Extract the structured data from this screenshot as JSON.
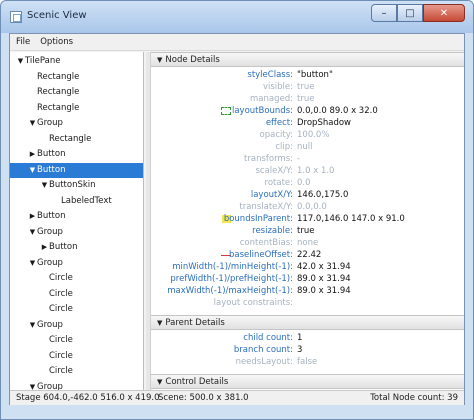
{
  "window": {
    "title": "Scenic View",
    "buttons": {
      "minimize": "–",
      "maximize": "□",
      "close": "✕"
    }
  },
  "menu": [
    "File",
    "Options"
  ],
  "tree": [
    {
      "label": "TilePane",
      "arrow": "▼",
      "depth": 0
    },
    {
      "label": "Rectangle",
      "arrow": "",
      "depth": 1
    },
    {
      "label": "Rectangle",
      "arrow": "",
      "depth": 1
    },
    {
      "label": "Rectangle",
      "arrow": "",
      "depth": 1
    },
    {
      "label": "Group",
      "arrow": "▼",
      "depth": 1
    },
    {
      "label": "Rectangle",
      "arrow": "",
      "depth": 2
    },
    {
      "label": "Button",
      "arrow": "▶",
      "depth": 1
    },
    {
      "label": "Button",
      "arrow": "▼",
      "depth": 1,
      "selected": true
    },
    {
      "label": "ButtonSkin",
      "arrow": "▼",
      "depth": 2
    },
    {
      "label": "LabeledText",
      "arrow": "",
      "depth": 3
    },
    {
      "label": "Button",
      "arrow": "▶",
      "depth": 1
    },
    {
      "label": "Group",
      "arrow": "▼",
      "depth": 1
    },
    {
      "label": "Button",
      "arrow": "▶",
      "depth": 2
    },
    {
      "label": "Group",
      "arrow": "▼",
      "depth": 1
    },
    {
      "label": "Circle",
      "arrow": "",
      "depth": 2
    },
    {
      "label": "Circle",
      "arrow": "",
      "depth": 2
    },
    {
      "label": "Circle",
      "arrow": "",
      "depth": 2
    },
    {
      "label": "Group",
      "arrow": "▼",
      "depth": 1
    },
    {
      "label": "Circle",
      "arrow": "",
      "depth": 2
    },
    {
      "label": "Circle",
      "arrow": "",
      "depth": 2
    },
    {
      "label": "Circle",
      "arrow": "",
      "depth": 2
    },
    {
      "label": "Group",
      "arrow": "▼",
      "depth": 1
    }
  ],
  "node_details": {
    "title": "Node Details",
    "props": [
      {
        "name": "styleClass:",
        "value": "\"button\"",
        "dim": false
      },
      {
        "name": "visible:",
        "value": "true",
        "dim": true
      },
      {
        "name": "managed:",
        "value": "true",
        "dim": true
      },
      {
        "name": "layoutBounds:",
        "value": "0.0,0.0  89.0 x 32.0",
        "dim": false,
        "glyph": "dashed"
      },
      {
        "name": "effect:",
        "value": "DropShadow",
        "dim": false
      },
      {
        "name": "opacity:",
        "value": "100.0%",
        "dim": true
      },
      {
        "name": "clip:",
        "value": "null",
        "dim": true
      },
      {
        "name": "transforms:",
        "value": "-",
        "dim": true
      },
      {
        "name": "scaleX/Y:",
        "value": "1.0 x 1.0",
        "dim": true
      },
      {
        "name": "rotate:",
        "value": "0.0",
        "dim": true
      },
      {
        "name": "layoutX/Y:",
        "value": "146.0,175.0",
        "dim": false
      },
      {
        "name": "translateX/Y:",
        "value": "0.0,0.0",
        "dim": true
      },
      {
        "name": "boundsInParent:",
        "value": "117.0,146.0  147.0 x 91.0",
        "dim": false,
        "glyph": "yellow"
      },
      {
        "name": "resizable:",
        "value": "true",
        "dim": false
      },
      {
        "name": "contentBias:",
        "value": "none",
        "dim": true
      },
      {
        "name": "baselineOffset:",
        "value": "22.42",
        "dim": false,
        "glyph": "line"
      },
      {
        "name": "minWidth(-1)/minHeight(-1):",
        "value": "42.0 x 31.94",
        "dim": false
      },
      {
        "name": "prefWidth(-1)/prefHeight(-1):",
        "value": "89.0 x 31.94",
        "dim": false
      },
      {
        "name": "maxWidth(-1)/maxHeight(-1):",
        "value": "89.0 x 31.94",
        "dim": false
      },
      {
        "name": "layout constraints:",
        "value": "",
        "dim": true
      }
    ]
  },
  "parent_details": {
    "title": "Parent Details",
    "props": [
      {
        "name": "child count:",
        "value": "1",
        "dim": false
      },
      {
        "name": "branch count:",
        "value": "3",
        "dim": false
      },
      {
        "name": "needsLayout:",
        "value": "false",
        "dim": true
      }
    ]
  },
  "control_details": {
    "title": "Control Details"
  },
  "status": {
    "stage": "Stage 604.0,-462.0  516.0 x 419.0",
    "scene": "Scene: 500.0 x 381.0",
    "total": "Total Node count: 39"
  },
  "colors": {
    "selection": "#2a7bd6",
    "prop_name": "#2a6ebd",
    "prop_dim": "#a6b2c0"
  },
  "icons": {
    "section_toggle": "▼"
  }
}
